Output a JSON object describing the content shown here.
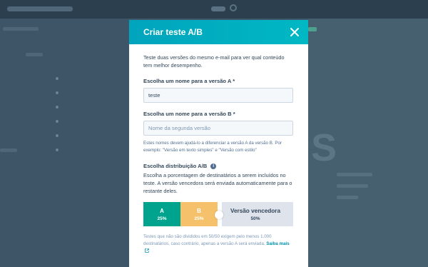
{
  "modal": {
    "title": "Criar teste A/B",
    "intro": "Teste duas versões do mesmo e-mail para ver qual conteúdo tem melhor desempenho.",
    "version_a": {
      "label": "Escolha um nome para a versão A *",
      "value": "teste"
    },
    "version_b": {
      "label": "Escolha um nome para a versão B *",
      "placeholder": "Nome da segunda versão"
    },
    "helper": "Estes nomes devem ajudá-lo a diferenciar a versão A da versão B. Por exemplo: \"Versão em texto simples\" e \"Versão com estilo\"",
    "distribution": {
      "label": "Escolha distribuição A/B",
      "description": "Escolha a porcentagem de destinatários a serem incluídos no teste. A versão vencedora será enviada automaticamente para o restante deles.",
      "segments": {
        "a": {
          "name": "A",
          "percent": "25%",
          "value": 0.25
        },
        "b": {
          "name": "B",
          "percent": "25%",
          "value": 0.25
        },
        "winner": {
          "name": "Versão vencedora",
          "percent": "50%",
          "value": 0.5
        }
      }
    },
    "footnote": "Testes que não são divididos em 50/50 exigem pelo menos 1.000 destinatários, caso contrário, apenas a versão A será enviada.",
    "learn_more": "Saiba mais"
  },
  "colors": {
    "header": "#00a4bd",
    "segment_a": "#00a38d",
    "segment_b": "#f5c26b",
    "segment_winner": "#dfe3eb"
  }
}
